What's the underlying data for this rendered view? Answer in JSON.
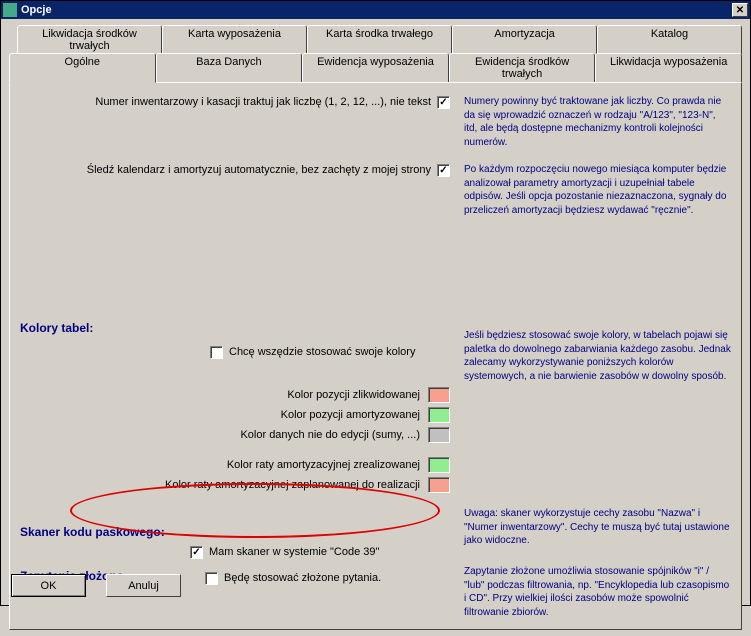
{
  "window": {
    "title": "Opcje"
  },
  "tabs_top": [
    "Likwidacja środków trwałych",
    "Karta wyposażenia",
    "Karta środka trwałego",
    "Amortyzacja",
    "Katalog"
  ],
  "tabs_bottom": [
    "Ogólne",
    "Baza Danych",
    "Ewidencja wyposażenia",
    "Ewidencja środków trwałych",
    "Likwidacja wyposażenia"
  ],
  "opt1": {
    "label": "Numer inwentarzowy i kasacji traktuj jak liczbę (1, 2, 12, ...), nie tekst",
    "help": "Numery powinny być traktowane jak liczby. Co prawda nie da się wprowadzić oznaczeń w rodzaju \"A/123\", \"123-N\", itd, ale będą dostępne mechanizmy kontroli kolejności numerów."
  },
  "opt2": {
    "label": "Śledź kalendarz i amortyzuj automatycznie, bez zachęty z mojej strony",
    "help": "Po każdym rozpoczęciu nowego miesiąca komputer będzie analizował parametry amortyzacji i uzupełniał tabele odpisów. Jeśli opcja pozostanie niezaznaczona, sygnały do przeliczeń amortyzacji będziesz wydawać \"ręcznie\"."
  },
  "sec_colors": {
    "title": "Kolory tabel:",
    "own_colors": "Chcę wszędzie stosować swoje kolory",
    "help": "Jeśli będziesz stosować swoje kolory, w tabelach pojawi się paletka do dowolnego zabarwiania każdego zasobu. Jednak zalecamy wykorzystywanie poniższych kolorów systemowych, a nie barwienie zasobów w dowolny sposób.",
    "c1": "Kolor pozycji zlikwidowanej",
    "c2": "Kolor pozycji amortyzowanej",
    "c3": "Kolor danych nie do edycji (sumy, ...)",
    "c4": "Kolor raty amortyzacyjnej zrealizowanej",
    "c5": "Kolor raty amortyzacyjnej zaplanowanej do realizacji",
    "swatches": {
      "c1": "#f8a090",
      "c2": "#90ee90",
      "c3": "#c0c0c0",
      "c4": "#90ee90",
      "c5": "#f8a090"
    }
  },
  "sec_scanner": {
    "title": "Skaner kodu paskowego:",
    "label": "Mam skaner w systemie \"Code 39\"",
    "help": "Uwaga: skaner wykorzystuje cechy zasobu \"Nazwa\" i \"Numer inwentarzowy\". Cechy te muszą być tutaj ustawione jako widoczne."
  },
  "sec_queries": {
    "title": "Zapytania złożone",
    "label": "Będę stosować złożone pytania.",
    "help": "Zapytanie złożone umożliwia stosowanie spójników \"i\" / \"lub\" podczas filtrowania, np. \"Encyklopedia lub czasopismo i CD\". Przy wielkiej ilości zasobów może spowolnić filtrowanie zbiorów."
  },
  "buttons": {
    "ok": "OK",
    "cancel": "Anuluj"
  }
}
